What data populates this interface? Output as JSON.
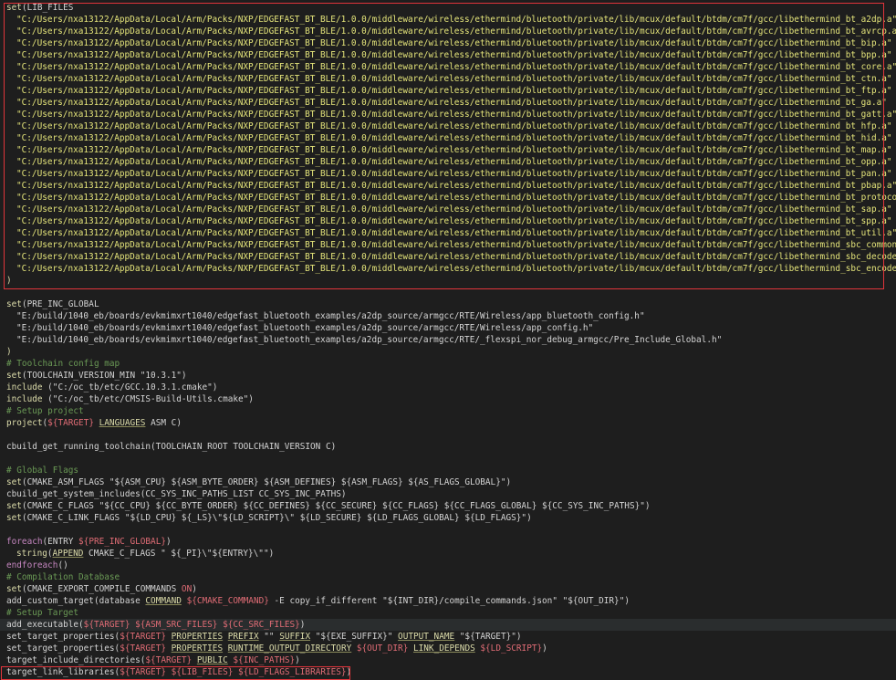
{
  "editor": {
    "lines": [
      [
        {
          "t": "set",
          "c": "t-key"
        },
        {
          "t": "(LIB_FILES",
          "c": "t-plain"
        }
      ],
      [
        {
          "t": "\"C:/Users/nxa13122/AppData/Local/Arm/Packs/NXP/EDGEFAST_BT_BLE/1.0.0/middleware/wireless/ethermind/bluetooth/private/lib/mcux/default/btdm/cm7f/gcc/libethermind_bt_a2dp.a\"",
          "c": "t-lib",
          "ind": 1
        }
      ],
      [
        {
          "t": "\"C:/Users/nxa13122/AppData/Local/Arm/Packs/NXP/EDGEFAST_BT_BLE/1.0.0/middleware/wireless/ethermind/bluetooth/private/lib/mcux/default/btdm/cm7f/gcc/libethermind_bt_avrcp.a\"",
          "c": "t-lib",
          "ind": 1
        }
      ],
      [
        {
          "t": "\"C:/Users/nxa13122/AppData/Local/Arm/Packs/NXP/EDGEFAST_BT_BLE/1.0.0/middleware/wireless/ethermind/bluetooth/private/lib/mcux/default/btdm/cm7f/gcc/libethermind_bt_bip.a\"",
          "c": "t-lib",
          "ind": 1
        }
      ],
      [
        {
          "t": "\"C:/Users/nxa13122/AppData/Local/Arm/Packs/NXP/EDGEFAST_BT_BLE/1.0.0/middleware/wireless/ethermind/bluetooth/private/lib/mcux/default/btdm/cm7f/gcc/libethermind_bt_bpp.a\"",
          "c": "t-lib",
          "ind": 1
        }
      ],
      [
        {
          "t": "\"C:/Users/nxa13122/AppData/Local/Arm/Packs/NXP/EDGEFAST_BT_BLE/1.0.0/middleware/wireless/ethermind/bluetooth/private/lib/mcux/default/btdm/cm7f/gcc/libethermind_bt_core.a\"",
          "c": "t-lib",
          "ind": 1
        }
      ],
      [
        {
          "t": "\"C:/Users/nxa13122/AppData/Local/Arm/Packs/NXP/EDGEFAST_BT_BLE/1.0.0/middleware/wireless/ethermind/bluetooth/private/lib/mcux/default/btdm/cm7f/gcc/libethermind_bt_ctn.a\"",
          "c": "t-lib",
          "ind": 1
        }
      ],
      [
        {
          "t": "\"C:/Users/nxa13122/AppData/Local/Arm/Packs/NXP/EDGEFAST_BT_BLE/1.0.0/middleware/wireless/ethermind/bluetooth/private/lib/mcux/default/btdm/cm7f/gcc/libethermind_bt_ftp.a\"",
          "c": "t-lib",
          "ind": 1
        }
      ],
      [
        {
          "t": "\"C:/Users/nxa13122/AppData/Local/Arm/Packs/NXP/EDGEFAST_BT_BLE/1.0.0/middleware/wireless/ethermind/bluetooth/private/lib/mcux/default/btdm/cm7f/gcc/libethermind_bt_ga.a\"",
          "c": "t-lib",
          "ind": 1
        }
      ],
      [
        {
          "t": "\"C:/Users/nxa13122/AppData/Local/Arm/Packs/NXP/EDGEFAST_BT_BLE/1.0.0/middleware/wireless/ethermind/bluetooth/private/lib/mcux/default/btdm/cm7f/gcc/libethermind_bt_gatt.a\"",
          "c": "t-lib",
          "ind": 1
        }
      ],
      [
        {
          "t": "\"C:/Users/nxa13122/AppData/Local/Arm/Packs/NXP/EDGEFAST_BT_BLE/1.0.0/middleware/wireless/ethermind/bluetooth/private/lib/mcux/default/btdm/cm7f/gcc/libethermind_bt_hfp.a\"",
          "c": "t-lib",
          "ind": 1
        }
      ],
      [
        {
          "t": "\"C:/Users/nxa13122/AppData/Local/Arm/Packs/NXP/EDGEFAST_BT_BLE/1.0.0/middleware/wireless/ethermind/bluetooth/private/lib/mcux/default/btdm/cm7f/gcc/libethermind_bt_hid.a\"",
          "c": "t-lib",
          "ind": 1
        }
      ],
      [
        {
          "t": "\"C:/Users/nxa13122/AppData/Local/Arm/Packs/NXP/EDGEFAST_BT_BLE/1.0.0/middleware/wireless/ethermind/bluetooth/private/lib/mcux/default/btdm/cm7f/gcc/libethermind_bt_map.a\"",
          "c": "t-lib",
          "ind": 1
        }
      ],
      [
        {
          "t": "\"C:/Users/nxa13122/AppData/Local/Arm/Packs/NXP/EDGEFAST_BT_BLE/1.0.0/middleware/wireless/ethermind/bluetooth/private/lib/mcux/default/btdm/cm7f/gcc/libethermind_bt_opp.a\"",
          "c": "t-lib",
          "ind": 1
        }
      ],
      [
        {
          "t": "\"C:/Users/nxa13122/AppData/Local/Arm/Packs/NXP/EDGEFAST_BT_BLE/1.0.0/middleware/wireless/ethermind/bluetooth/private/lib/mcux/default/btdm/cm7f/gcc/libethermind_bt_pan.a\"",
          "c": "t-lib",
          "ind": 1
        }
      ],
      [
        {
          "t": "\"C:/Users/nxa13122/AppData/Local/Arm/Packs/NXP/EDGEFAST_BT_BLE/1.0.0/middleware/wireless/ethermind/bluetooth/private/lib/mcux/default/btdm/cm7f/gcc/libethermind_bt_pbap.a\"",
          "c": "t-lib",
          "ind": 1
        }
      ],
      [
        {
          "t": "\"C:/Users/nxa13122/AppData/Local/Arm/Packs/NXP/EDGEFAST_BT_BLE/1.0.0/middleware/wireless/ethermind/bluetooth/private/lib/mcux/default/btdm/cm7f/gcc/libethermind_bt_protocol.a\"",
          "c": "t-lib",
          "ind": 1
        }
      ],
      [
        {
          "t": "\"C:/Users/nxa13122/AppData/Local/Arm/Packs/NXP/EDGEFAST_BT_BLE/1.0.0/middleware/wireless/ethermind/bluetooth/private/lib/mcux/default/btdm/cm7f/gcc/libethermind_bt_sap.a\"",
          "c": "t-lib",
          "ind": 1
        }
      ],
      [
        {
          "t": "\"C:/Users/nxa13122/AppData/Local/Arm/Packs/NXP/EDGEFAST_BT_BLE/1.0.0/middleware/wireless/ethermind/bluetooth/private/lib/mcux/default/btdm/cm7f/gcc/libethermind_bt_spp.a\"",
          "c": "t-lib",
          "ind": 1
        }
      ],
      [
        {
          "t": "\"C:/Users/nxa13122/AppData/Local/Arm/Packs/NXP/EDGEFAST_BT_BLE/1.0.0/middleware/wireless/ethermind/bluetooth/private/lib/mcux/default/btdm/cm7f/gcc/libethermind_bt_util.a\"",
          "c": "t-lib",
          "ind": 1
        }
      ],
      [
        {
          "t": "\"C:/Users/nxa13122/AppData/Local/Arm/Packs/NXP/EDGEFAST_BT_BLE/1.0.0/middleware/wireless/ethermind/bluetooth/private/lib/mcux/default/btdm/cm7f/gcc/libethermind_sbc_common.a\"",
          "c": "t-lib",
          "ind": 1
        }
      ],
      [
        {
          "t": "\"C:/Users/nxa13122/AppData/Local/Arm/Packs/NXP/EDGEFAST_BT_BLE/1.0.0/middleware/wireless/ethermind/bluetooth/private/lib/mcux/default/btdm/cm7f/gcc/libethermind_sbc_decoder.a\"",
          "c": "t-lib",
          "ind": 1
        }
      ],
      [
        {
          "t": "\"C:/Users/nxa13122/AppData/Local/Arm/Packs/NXP/EDGEFAST_BT_BLE/1.0.0/middleware/wireless/ethermind/bluetooth/private/lib/mcux/default/btdm/cm7f/gcc/libethermind_sbc_encoder.a\"",
          "c": "t-lib",
          "ind": 1
        }
      ],
      [
        {
          "t": ")",
          "c": "t-key"
        }
      ],
      [],
      [
        {
          "t": "set",
          "c": "t-key"
        },
        {
          "t": "(PRE_INC_GLOBAL",
          "c": "t-plain"
        }
      ],
      [
        {
          "t": "\"E:/build/1040_eb/boards/evkmimxrt1040/edgefast_bluetooth_examples/a2dp_source/armgcc/RTE/Wireless/app_bluetooth_config.h\"",
          "c": "t-plain",
          "ind": 1
        }
      ],
      [
        {
          "t": "\"E:/build/1040_eb/boards/evkmimxrt1040/edgefast_bluetooth_examples/a2dp_source/armgcc/RTE/Wireless/app_config.h\"",
          "c": "t-plain",
          "ind": 1
        }
      ],
      [
        {
          "t": "\"E:/build/1040_eb/boards/evkmimxrt1040/edgefast_bluetooth_examples/a2dp_source/armgcc/RTE/_flexspi_nor_debug_armgcc/Pre_Include_Global.h\"",
          "c": "t-plain",
          "ind": 1
        }
      ],
      [
        {
          "t": ")",
          "c": "t-key"
        }
      ],
      [
        {
          "t": "# Toolchain config map",
          "c": "t-cmt"
        }
      ],
      [
        {
          "t": "set",
          "c": "t-key"
        },
        {
          "t": "(TOOLCHAIN_VERSION_MIN \"10.3.1\")",
          "c": "t-plain"
        }
      ],
      [
        {
          "t": "include",
          "c": "t-key"
        },
        {
          "t": " (\"C:/oc_tb/etc/GCC.10.3.1.cmake\")",
          "c": "t-plain"
        }
      ],
      [
        {
          "t": "include",
          "c": "t-key"
        },
        {
          "t": " (\"C:/oc_tb/etc/CMSIS-Build-Utils.cmake\")",
          "c": "t-plain"
        }
      ],
      [
        {
          "t": "# Setup project",
          "c": "t-cmt"
        }
      ],
      [
        {
          "t": "project",
          "c": "t-key"
        },
        {
          "t": "(",
          "c": "t-plain"
        },
        {
          "t": "${TARGET}",
          "c": "t-var"
        },
        {
          "t": " ",
          "c": "t-plain"
        },
        {
          "t": "LANGUAGES",
          "c": "t-prop"
        },
        {
          "t": " ASM C)",
          "c": "t-plain"
        }
      ],
      [],
      [
        {
          "t": "cbuild_get_running_toolchain(TOOLCHAIN_ROOT TOOLCHAIN_VERSION C)",
          "c": "t-plain"
        }
      ],
      [],
      [
        {
          "t": "# Global Flags",
          "c": "t-cmt"
        }
      ],
      [
        {
          "t": "set",
          "c": "t-key"
        },
        {
          "t": "(CMAKE_ASM_FLAGS \"${ASM_CPU} ${ASM_BYTE_ORDER} ${ASM_DEFINES} ${ASM_FLAGS} ${AS_FLAGS_GLOBAL}\")",
          "c": "t-plain"
        }
      ],
      [
        {
          "t": "cbuild_get_system_includes(CC_SYS_INC_PATHS_LIST CC_SYS_INC_PATHS)",
          "c": "t-plain"
        }
      ],
      [
        {
          "t": "set",
          "c": "t-key"
        },
        {
          "t": "(CMAKE_C_FLAGS \"${CC_CPU} ${CC_BYTE_ORDER} ${CC_DEFINES} ${CC_SECURE} ${CC_FLAGS} ${CC_FLAGS_GLOBAL} ${CC_SYS_INC_PATHS}\")",
          "c": "t-plain"
        }
      ],
      [
        {
          "t": "set",
          "c": "t-key"
        },
        {
          "t": "(CMAKE_C_LINK_FLAGS \"${LD_CPU} ${_LS}\\\"${LD_SCRIPT}\\\" ${LD_SECURE} ${LD_FLAGS_GLOBAL} ${LD_FLAGS}\")",
          "c": "t-plain"
        }
      ],
      [],
      [
        {
          "t": "foreach",
          "c": "t-kw"
        },
        {
          "t": "(ENTRY ",
          "c": "t-plain"
        },
        {
          "t": "${PRE_INC_GLOBAL}",
          "c": "t-var"
        },
        {
          "t": ")",
          "c": "t-plain"
        }
      ],
      [
        {
          "t": "string",
          "c": "t-key",
          "ind": 1
        },
        {
          "t": "(",
          "c": "t-plain"
        },
        {
          "t": "APPEND",
          "c": "t-prop"
        },
        {
          "t": " CMAKE_C_FLAGS \" ${_PI}\\\"${ENTRY}\\\"\")",
          "c": "t-plain"
        }
      ],
      [
        {
          "t": "endforeach",
          "c": "t-kw"
        },
        {
          "t": "()",
          "c": "t-plain"
        }
      ],
      [
        {
          "t": "# Compilation Database",
          "c": "t-cmt"
        }
      ],
      [
        {
          "t": "set",
          "c": "t-key"
        },
        {
          "t": "(CMAKE_EXPORT_COMPILE_COMMANDS ",
          "c": "t-plain"
        },
        {
          "t": "ON",
          "c": "t-var"
        },
        {
          "t": ")",
          "c": "t-plain"
        }
      ],
      [
        {
          "t": "add_custom_target(database ",
          "c": "t-plain"
        },
        {
          "t": "COMMAND",
          "c": "t-prop"
        },
        {
          "t": " ",
          "c": "t-plain"
        },
        {
          "t": "${CMAKE_COMMAND}",
          "c": "t-var"
        },
        {
          "t": " -E copy_if_different \"${INT_DIR}/compile_commands.json\" \"${OUT_DIR}\")",
          "c": "t-plain"
        }
      ],
      [
        {
          "t": "# Setup Target",
          "c": "t-cmt"
        }
      ],
      [
        {
          "t": "add_executable(",
          "c": "t-plain"
        },
        {
          "t": "${TARGET}",
          "c": "t-var"
        },
        {
          "t": " ",
          "c": "t-plain"
        },
        {
          "t": "${ASM_SRC_FILES}",
          "c": "t-var"
        },
        {
          "t": " ",
          "c": "t-plain"
        },
        {
          "t": "${CC_SRC_FILES}",
          "c": "t-var"
        },
        {
          "t": ")",
          "c": "t-plain"
        }
      ],
      [
        {
          "t": "set_target_properties(",
          "c": "t-plain"
        },
        {
          "t": "${TARGET}",
          "c": "t-var"
        },
        {
          "t": " ",
          "c": "t-plain"
        },
        {
          "t": "PROPERTIES",
          "c": "t-prop"
        },
        {
          "t": " ",
          "c": "t-plain"
        },
        {
          "t": "PREFIX",
          "c": "t-prop"
        },
        {
          "t": " \"\" ",
          "c": "t-plain"
        },
        {
          "t": "SUFFIX",
          "c": "t-prop"
        },
        {
          "t": " \"${EXE_SUFFIX}\" ",
          "c": "t-plain"
        },
        {
          "t": "OUTPUT_NAME",
          "c": "t-prop"
        },
        {
          "t": " \"${TARGET}\")",
          "c": "t-plain"
        }
      ],
      [
        {
          "t": "set_target_properties(",
          "c": "t-plain"
        },
        {
          "t": "${TARGET}",
          "c": "t-var"
        },
        {
          "t": " ",
          "c": "t-plain"
        },
        {
          "t": "PROPERTIES",
          "c": "t-prop"
        },
        {
          "t": " ",
          "c": "t-plain"
        },
        {
          "t": "RUNTIME_OUTPUT_DIRECTORY",
          "c": "t-prop"
        },
        {
          "t": " ",
          "c": "t-plain"
        },
        {
          "t": "${OUT_DIR}",
          "c": "t-var"
        },
        {
          "t": " ",
          "c": "t-plain"
        },
        {
          "t": "LINK_DEPENDS",
          "c": "t-prop"
        },
        {
          "t": " ",
          "c": "t-plain"
        },
        {
          "t": "${LD_SCRIPT}",
          "c": "t-var"
        },
        {
          "t": ")",
          "c": "t-plain"
        }
      ],
      [
        {
          "t": "target_include_directories(",
          "c": "t-plain"
        },
        {
          "t": "${TARGET}",
          "c": "t-var"
        },
        {
          "t": " ",
          "c": "t-plain"
        },
        {
          "t": "PUBLIC",
          "c": "t-prop"
        },
        {
          "t": " ",
          "c": "t-plain"
        },
        {
          "t": "${INC_PATHS}",
          "c": "t-var"
        },
        {
          "t": ")",
          "c": "t-plain"
        }
      ],
      [
        {
          "t": "target_link_libraries(",
          "c": "t-plain"
        },
        {
          "t": "${TARGET}",
          "c": "t-var"
        },
        {
          "t": " ",
          "c": "t-plain"
        },
        {
          "t": "${LIB_FILES}",
          "c": "t-var"
        },
        {
          "t": " ",
          "c": "t-plain"
        },
        {
          "t": "${LD_FLAGS_LIBRARIES}",
          "c": "t-var"
        },
        {
          "t": ")",
          "c": "t-plain"
        }
      ]
    ],
    "current_line": 52
  }
}
